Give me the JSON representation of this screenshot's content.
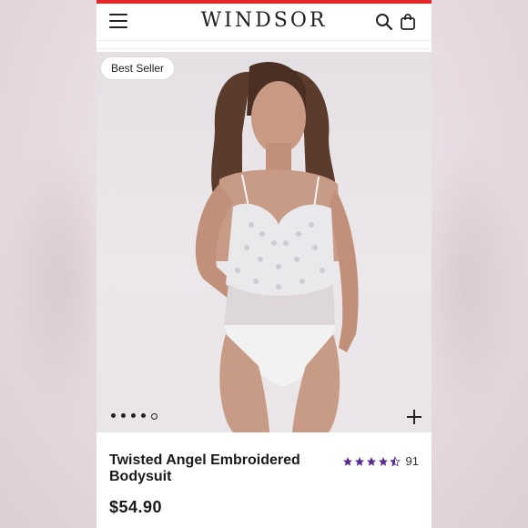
{
  "header": {
    "logo_text": "WINDSOR",
    "menu_icon": "hamburger-menu-icon",
    "search_icon": "search-icon",
    "bag_icon": "shopping-bag-icon"
  },
  "product": {
    "badge": "Best Seller",
    "title": "Twisted Angel Embroidered Bodysuit",
    "price": "$54.90",
    "rating_value": 4.5,
    "review_count": "91",
    "carousel_total": 5,
    "carousel_active": 4
  },
  "colors": {
    "accent_red": "#e2262c",
    "star_purple": "#5b2d91",
    "text": "#1a1a1a"
  }
}
